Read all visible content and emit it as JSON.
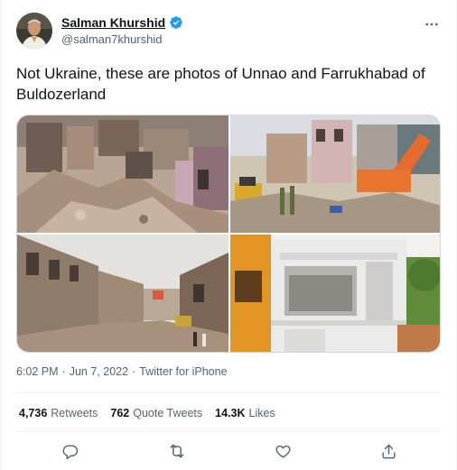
{
  "author": {
    "display_name": "Salman Khurshid",
    "handle": "@salman7khurshid",
    "verified": true
  },
  "tweet": {
    "text": "Not Ukraine, these are photos of Unnao and Farrukhabad of Buldozerland",
    "time": "6:02 PM",
    "separator_1": "·",
    "date": "Jun 7, 2022",
    "separator_2": "·",
    "source": "Twitter for iPhone"
  },
  "photos": [
    {
      "description": "demolished buildings rubble"
    },
    {
      "description": "bulldozer and crowd at demolition site"
    },
    {
      "description": "street lined with demolished houses"
    },
    {
      "description": "partially demolished orange building"
    }
  ],
  "stats": {
    "retweets_count": "4,736",
    "retweets_label": "Retweets",
    "quotes_count": "762",
    "quotes_label": "Quote Tweets",
    "likes_count": "14.3K",
    "likes_label": "Likes"
  },
  "icons": {
    "reply": "reply-icon",
    "retweet": "retweet-icon",
    "like": "heart-icon",
    "share": "share-icon",
    "more": "more-icon",
    "verified": "verified-badge-icon"
  },
  "colors": {
    "accent": "#1d9bf0",
    "text_primary": "#0f1419",
    "text_secondary": "#536471"
  }
}
